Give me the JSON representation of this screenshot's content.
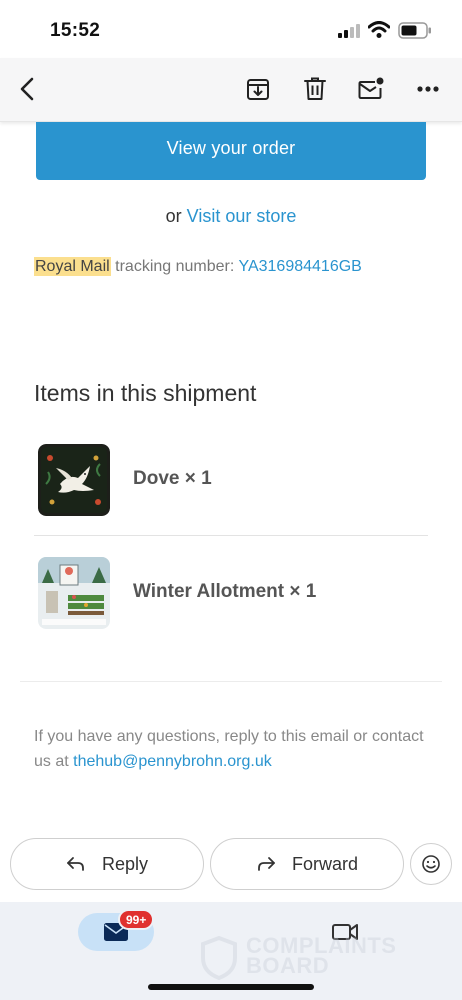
{
  "status_bar": {
    "time": "15:52"
  },
  "toolbar": {
    "icons": [
      "back-icon",
      "archive-icon",
      "trash-icon",
      "mark-unread-icon",
      "more-icon"
    ]
  },
  "email": {
    "view_order_button": "View your order",
    "or_text": "or",
    "visit_store_link": "Visit our store",
    "tracking": {
      "carrier": "Royal Mail",
      "label": "tracking number:",
      "number": "YA316984416GB"
    },
    "items_heading": "Items in this shipment",
    "items": [
      {
        "title": "Dove × 1",
        "thumbnail": "dove-artwork-thumbnail"
      },
      {
        "title": "Winter Allotment × 1",
        "thumbnail": "winter-allotment-artwork-thumbnail"
      }
    ],
    "footer_text": "If you have any questions, reply to this email or contact us at",
    "footer_email": "thehub@pennybrohn.org.uk"
  },
  "actions": {
    "reply_label": "Reply",
    "forward_label": "Forward"
  },
  "tabbar": {
    "mail_badge": "99+",
    "watermark_text": "COMPLAINTS BOARD"
  },
  "colors": {
    "accent": "#2a94cf",
    "highlight": "#fbdf8e",
    "badge": "#e0312f"
  }
}
